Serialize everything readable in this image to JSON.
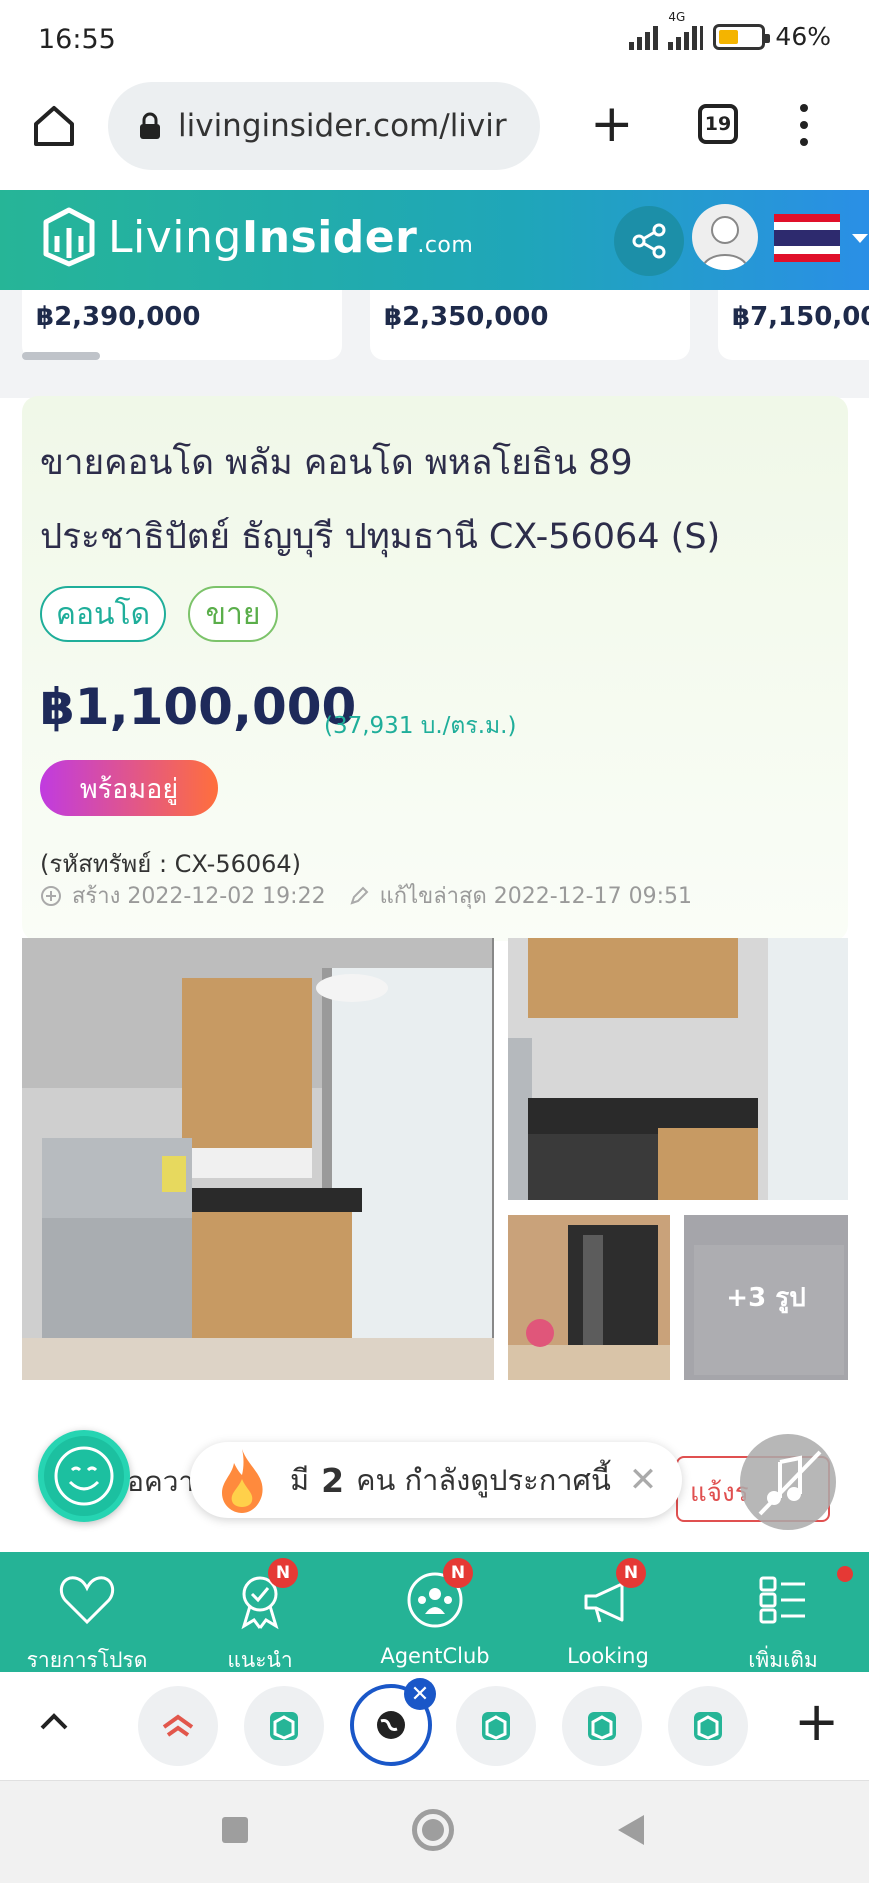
{
  "status_bar": {
    "time": "16:55",
    "network": "4G",
    "battery": "46%",
    "battery_level": 0.46
  },
  "browser": {
    "url": "livinginsider.com/livir",
    "tab_count": "19"
  },
  "site": {
    "logo_light": "Living",
    "logo_bold": "Insider",
    "logo_suffix": ".com"
  },
  "related": {
    "prices": [
      "฿2,390,000",
      "฿2,350,000",
      "฿7,150,00"
    ]
  },
  "listing": {
    "title": "ขายคอนโด พลัม คอนโด พหลโยธิน 89 ประชาธิปัตย์ ธัญบุรี ปทุมธานี CX-56064 (S)",
    "tags": [
      "คอนโด",
      "ขาย"
    ],
    "price": "฿1,100,000",
    "price_per_sqm": "(37,931 บ./ตร.ม.)",
    "status": "พร้อมอยู่",
    "code": "(รหัสทรัพย์ : CX-56064)",
    "created": "สร้าง 2022-12-02 19:22",
    "edited": "แก้ไขล่าสุด 2022-12-17 09:51"
  },
  "photos": {
    "more_label": "+3 รูป"
  },
  "below": {
    "detail_label": "ข้อควา",
    "report_label": "แจ้งร"
  },
  "viewers": {
    "prefix": "มี",
    "count": "2",
    "suffix": "คน กำลังดูประกาศนี้"
  },
  "site_nav": [
    {
      "label": "รายการโปรด",
      "icon": "heart-icon",
      "badge": ""
    },
    {
      "label": "แนะนำ",
      "icon": "award-icon",
      "badge": "N"
    },
    {
      "label": "AgentClub",
      "icon": "agent-club-icon",
      "badge": "N"
    },
    {
      "label": "Looking",
      "icon": "megaphone-icon",
      "badge": "N"
    },
    {
      "label": "เพิ่มเติม",
      "icon": "list-icon",
      "badge": ""
    }
  ],
  "colors": {
    "brand": "#25b396",
    "price": "#1e2a5a",
    "accent_red": "#e53935"
  }
}
